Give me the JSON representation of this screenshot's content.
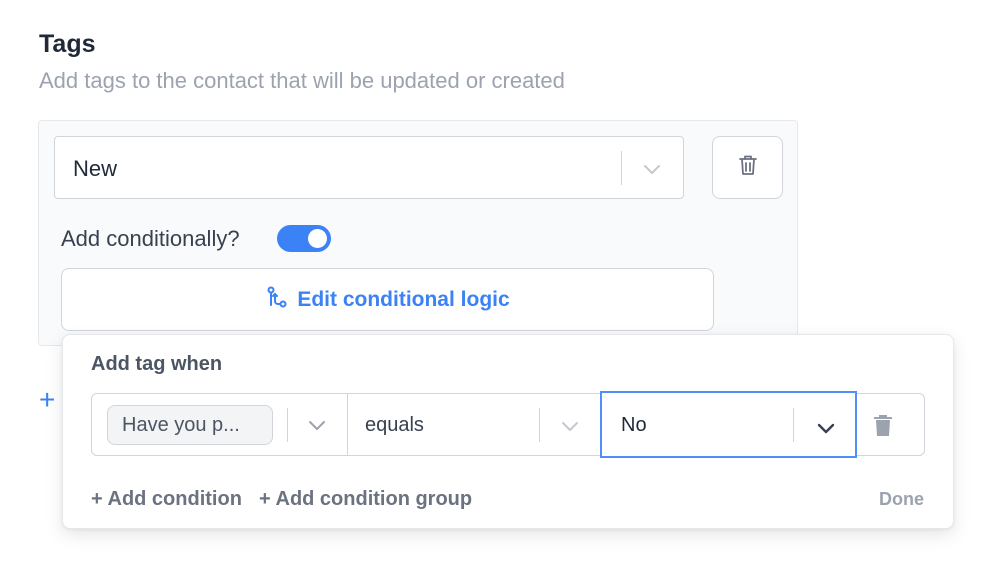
{
  "section": {
    "title": "Tags",
    "subtitle": "Add tags to the contact that will be updated or created"
  },
  "tag_select": {
    "value": "New"
  },
  "conditional": {
    "label": "Add conditionally?",
    "enabled": true,
    "edit_button_label": "Edit conditional logic"
  },
  "popover": {
    "title": "Add tag when",
    "condition": {
      "field": "Have you p...",
      "operator": "equals",
      "value": "No"
    },
    "add_condition_label": "+ Add condition",
    "add_group_label": "+ Add condition group",
    "done_label": "Done"
  },
  "partial_add_label": "+",
  "colors": {
    "accent": "#3b82f6",
    "focus_border": "#4f8ff7",
    "muted_text": "#9ca3af"
  },
  "icons": [
    "chevron-down-icon",
    "trash-icon",
    "branch-logic-icon",
    "plus-icon"
  ]
}
